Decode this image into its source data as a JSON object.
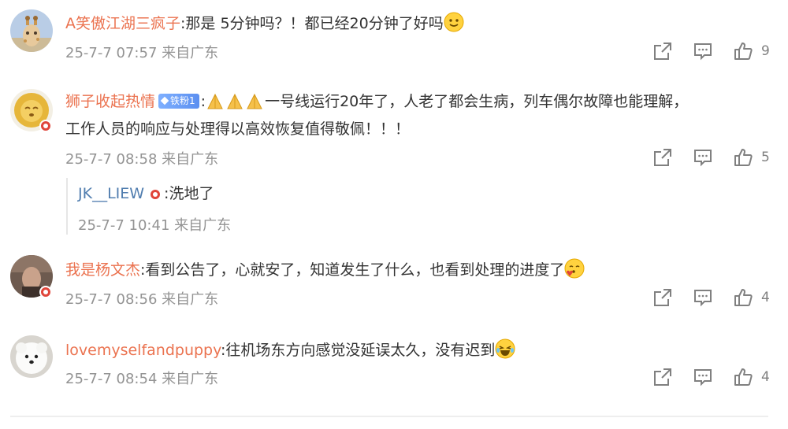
{
  "comments": [
    {
      "username": "A笑傲江湖三疯子",
      "text": ":那是 5分钟吗？！都已经20分钟了好吗",
      "time": "25-7-7 07:57",
      "location": "来自广东",
      "likes": "9",
      "avatar": "giraffe-avatar"
    },
    {
      "username": "狮子收起热情",
      "fan_badge": "铁粉1",
      "text_line1": "一号线运行20年了，人老了都会生病，列车偶尔故障也能理解，",
      "text_line2": "工作人员的响应与处理得以高效恢复值得敬佩！！！",
      "time": "25-7-7 08:58",
      "location": "来自广东",
      "likes": "5",
      "avatar": "lion-avatar",
      "reply": {
        "username": "JK__LIEW",
        "text": ":洗地了",
        "time": "25-7-7 10:41",
        "location": "来自广东"
      }
    },
    {
      "username": "我是杨文杰",
      "text": ":看到公告了，心就安了，知道发生了什么，也看到处理的进度了",
      "time": "25-7-7 08:56",
      "location": "来自广东",
      "likes": "4",
      "avatar": "portrait-avatar"
    },
    {
      "username": "lovemyselfandpuppy",
      "text": ":往机场东方向感觉没延误太久，没有迟到",
      "time": "25-7-7 08:54",
      "location": "来自广东",
      "likes": "4",
      "avatar": "puppy-avatar"
    }
  ],
  "colors": {
    "username": "#eb7350",
    "reply_username": "#507daf",
    "meta": "#939393",
    "icon": "#808080",
    "verified_badge": "#e0453a"
  }
}
